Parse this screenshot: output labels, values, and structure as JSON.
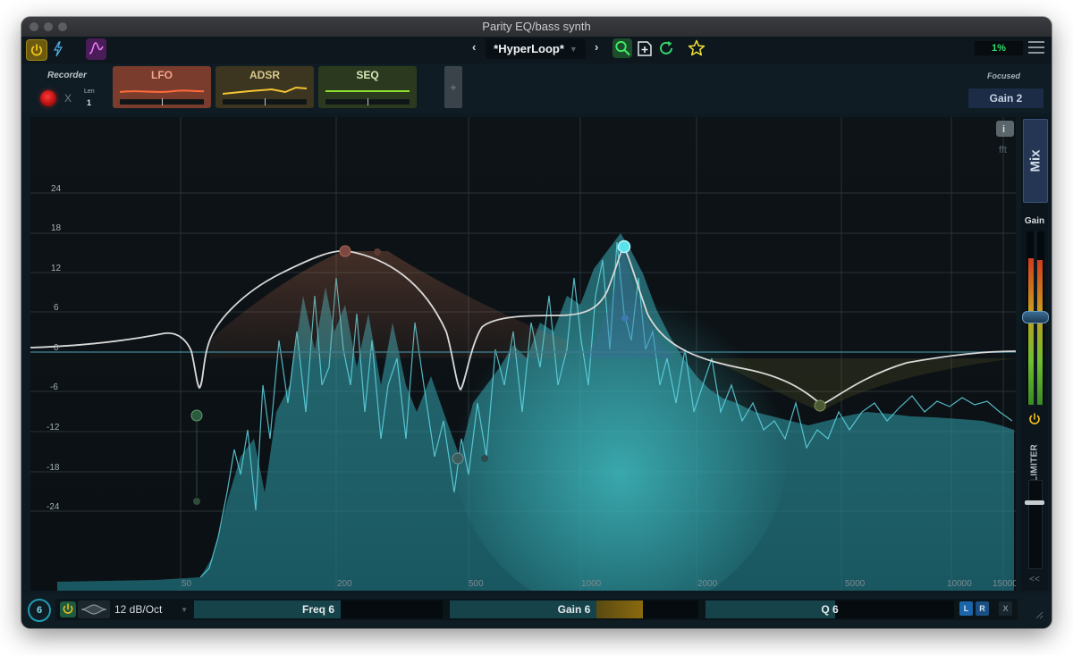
{
  "window": {
    "title": "Parity EQ/bass synth"
  },
  "toolbar": {
    "preset_name": "*HyperLoop*",
    "prev_label": "‹",
    "next_label": "›",
    "cpu_usage": "1%"
  },
  "modulators": {
    "recorder_label": "Recorder",
    "recorder_close": "X",
    "len_label": "Len",
    "len_value": "1",
    "items": [
      {
        "label": "LFO",
        "color": "#e0552f"
      },
      {
        "label": "ADSR",
        "color": "#c9a21d"
      },
      {
        "label": "SEQ",
        "color": "#8ccc26"
      }
    ],
    "add_label": "+",
    "focused_label": "Focused",
    "focused_value": "Gain 2"
  },
  "eq": {
    "db_labels": [
      "24",
      "18",
      "12",
      "6",
      "0",
      "-6",
      "-12",
      "-18",
      "-24"
    ],
    "freq_labels": [
      "50",
      "200",
      "500",
      "1000",
      "2000",
      "5000",
      "10000",
      "15000"
    ],
    "info_label": "i",
    "fft_label": "fft",
    "accent_color": "#3fd2df"
  },
  "sidebar": {
    "mix_label": "Mix",
    "gain_label": "Gain",
    "limiter_label": "LIMITER",
    "collapse_label": "<<"
  },
  "band": {
    "number": "6",
    "slope": "12 dB/Oct",
    "freq_label": "Freq 6",
    "gain_label": "Gain 6",
    "q_label": "Q 6",
    "left_label": "L",
    "right_label": "R",
    "close_label": "X"
  }
}
